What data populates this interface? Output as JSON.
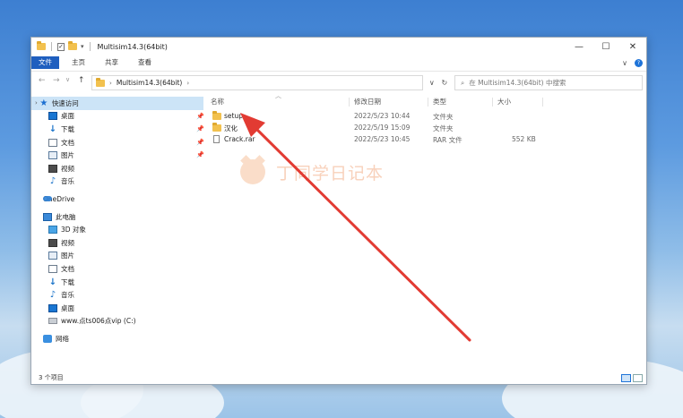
{
  "window": {
    "title": "Multisim14.3(64bit)",
    "controls": {
      "minimize": "—",
      "maximize": "☐",
      "close": "✕"
    }
  },
  "ribbon": {
    "tabs": [
      "文件",
      "主页",
      "共享",
      "查看"
    ],
    "expand_glyph": "∨"
  },
  "address": {
    "path": [
      "Multisim14.3(64bit)"
    ],
    "search_placeholder": "在 Multisim14.3(64bit) 中搜索"
  },
  "sidebar": {
    "quick_access": "快速访问",
    "quick_items": [
      {
        "label": "桌面",
        "icon": "desktop-icon"
      },
      {
        "label": "下载",
        "icon": "download-icon"
      },
      {
        "label": "文档",
        "icon": "document-icon"
      },
      {
        "label": "图片",
        "icon": "picture-icon"
      },
      {
        "label": "视频",
        "icon": "video-icon"
      },
      {
        "label": "音乐",
        "icon": "music-icon"
      }
    ],
    "onedrive": "OneDrive",
    "this_pc": "此电脑",
    "pc_items": [
      {
        "label": "3D 对象",
        "icon": "3d-objects-icon"
      },
      {
        "label": "视频",
        "icon": "video-icon"
      },
      {
        "label": "图片",
        "icon": "picture-icon"
      },
      {
        "label": "文档",
        "icon": "document-icon"
      },
      {
        "label": "下载",
        "icon": "download-icon"
      },
      {
        "label": "音乐",
        "icon": "music-icon"
      },
      {
        "label": "桌面",
        "icon": "desktop-icon"
      },
      {
        "label": "www.点ts006点vip (C:)",
        "icon": "drive-icon"
      }
    ],
    "network": "网络"
  },
  "columns": {
    "name": "名称",
    "date": "修改日期",
    "type": "类型",
    "size": "大小"
  },
  "files": [
    {
      "name": "setup",
      "date": "2022/5/23 10:44",
      "type": "文件夹",
      "size": "",
      "icon": "folder-icon"
    },
    {
      "name": "汉化",
      "date": "2022/5/19 15:09",
      "type": "文件夹",
      "size": "",
      "icon": "folder-icon"
    },
    {
      "name": "Crack.rar",
      "date": "2022/5/23 10:45",
      "type": "RAR 文件",
      "size": "552 KB",
      "icon": "file-icon"
    }
  ],
  "status": {
    "count": "3 个项目"
  },
  "watermark": {
    "text": "丁同学日记本"
  },
  "colors": {
    "accent": "#1f5fbf",
    "selection": "#cce4f7",
    "arrow": "#e23b33",
    "folder": "#f2c14e"
  }
}
